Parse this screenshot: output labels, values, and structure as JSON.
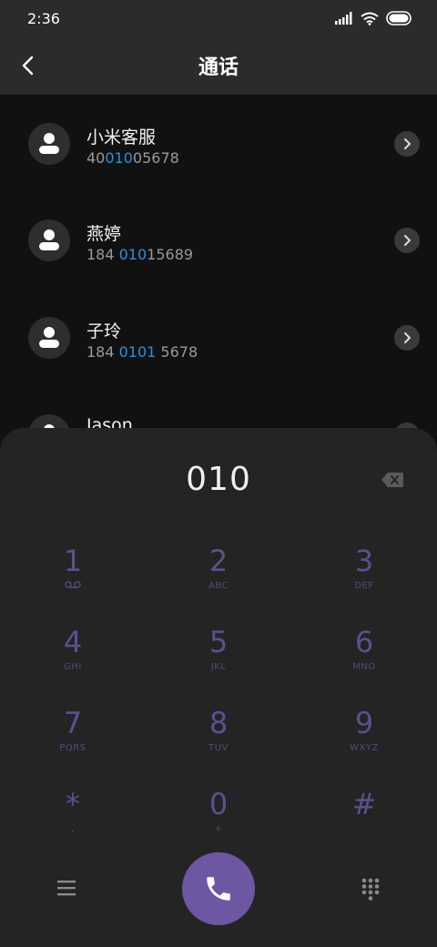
{
  "status": {
    "time": "2:36"
  },
  "header": {
    "title": "通话"
  },
  "contacts": [
    {
      "name": "小米客服",
      "number_pre": "40",
      "number_match": "010",
      "number_post": "05678"
    },
    {
      "name": "燕婷",
      "number_pre": "184 ",
      "number_match": "010",
      "number_post": "15689"
    },
    {
      "name": "子玲",
      "number_pre": "184 ",
      "number_match": "0101",
      "number_post": " 5678"
    },
    {
      "name": "Jason",
      "number_pre": "",
      "number_match": "",
      "number_post": ""
    }
  ],
  "dialer": {
    "input": "010",
    "keys": [
      {
        "digit": "1",
        "letters": ""
      },
      {
        "digit": "2",
        "letters": "ABC"
      },
      {
        "digit": "3",
        "letters": "DEF"
      },
      {
        "digit": "4",
        "letters": "GHI"
      },
      {
        "digit": "5",
        "letters": "JKL"
      },
      {
        "digit": "6",
        "letters": "MNO"
      },
      {
        "digit": "7",
        "letters": "PQRS"
      },
      {
        "digit": "8",
        "letters": "TUV"
      },
      {
        "digit": "9",
        "letters": "WXYZ"
      },
      {
        "digit": "*",
        "letters": ","
      },
      {
        "digit": "0",
        "letters": "+"
      },
      {
        "digit": "#",
        "letters": ""
      }
    ]
  },
  "icons": {
    "back": "back-arrow-icon",
    "detail": "chevron-right-icon",
    "backspace": "backspace-icon",
    "voicemail": "voicemail-icon",
    "menu": "menu-icon",
    "call": "phone-icon",
    "keypad": "dialpad-icon"
  },
  "colors": {
    "accent": "#6d57a3",
    "key_text": "#5e4f8f",
    "match_highlight": "#2f8fdc"
  }
}
